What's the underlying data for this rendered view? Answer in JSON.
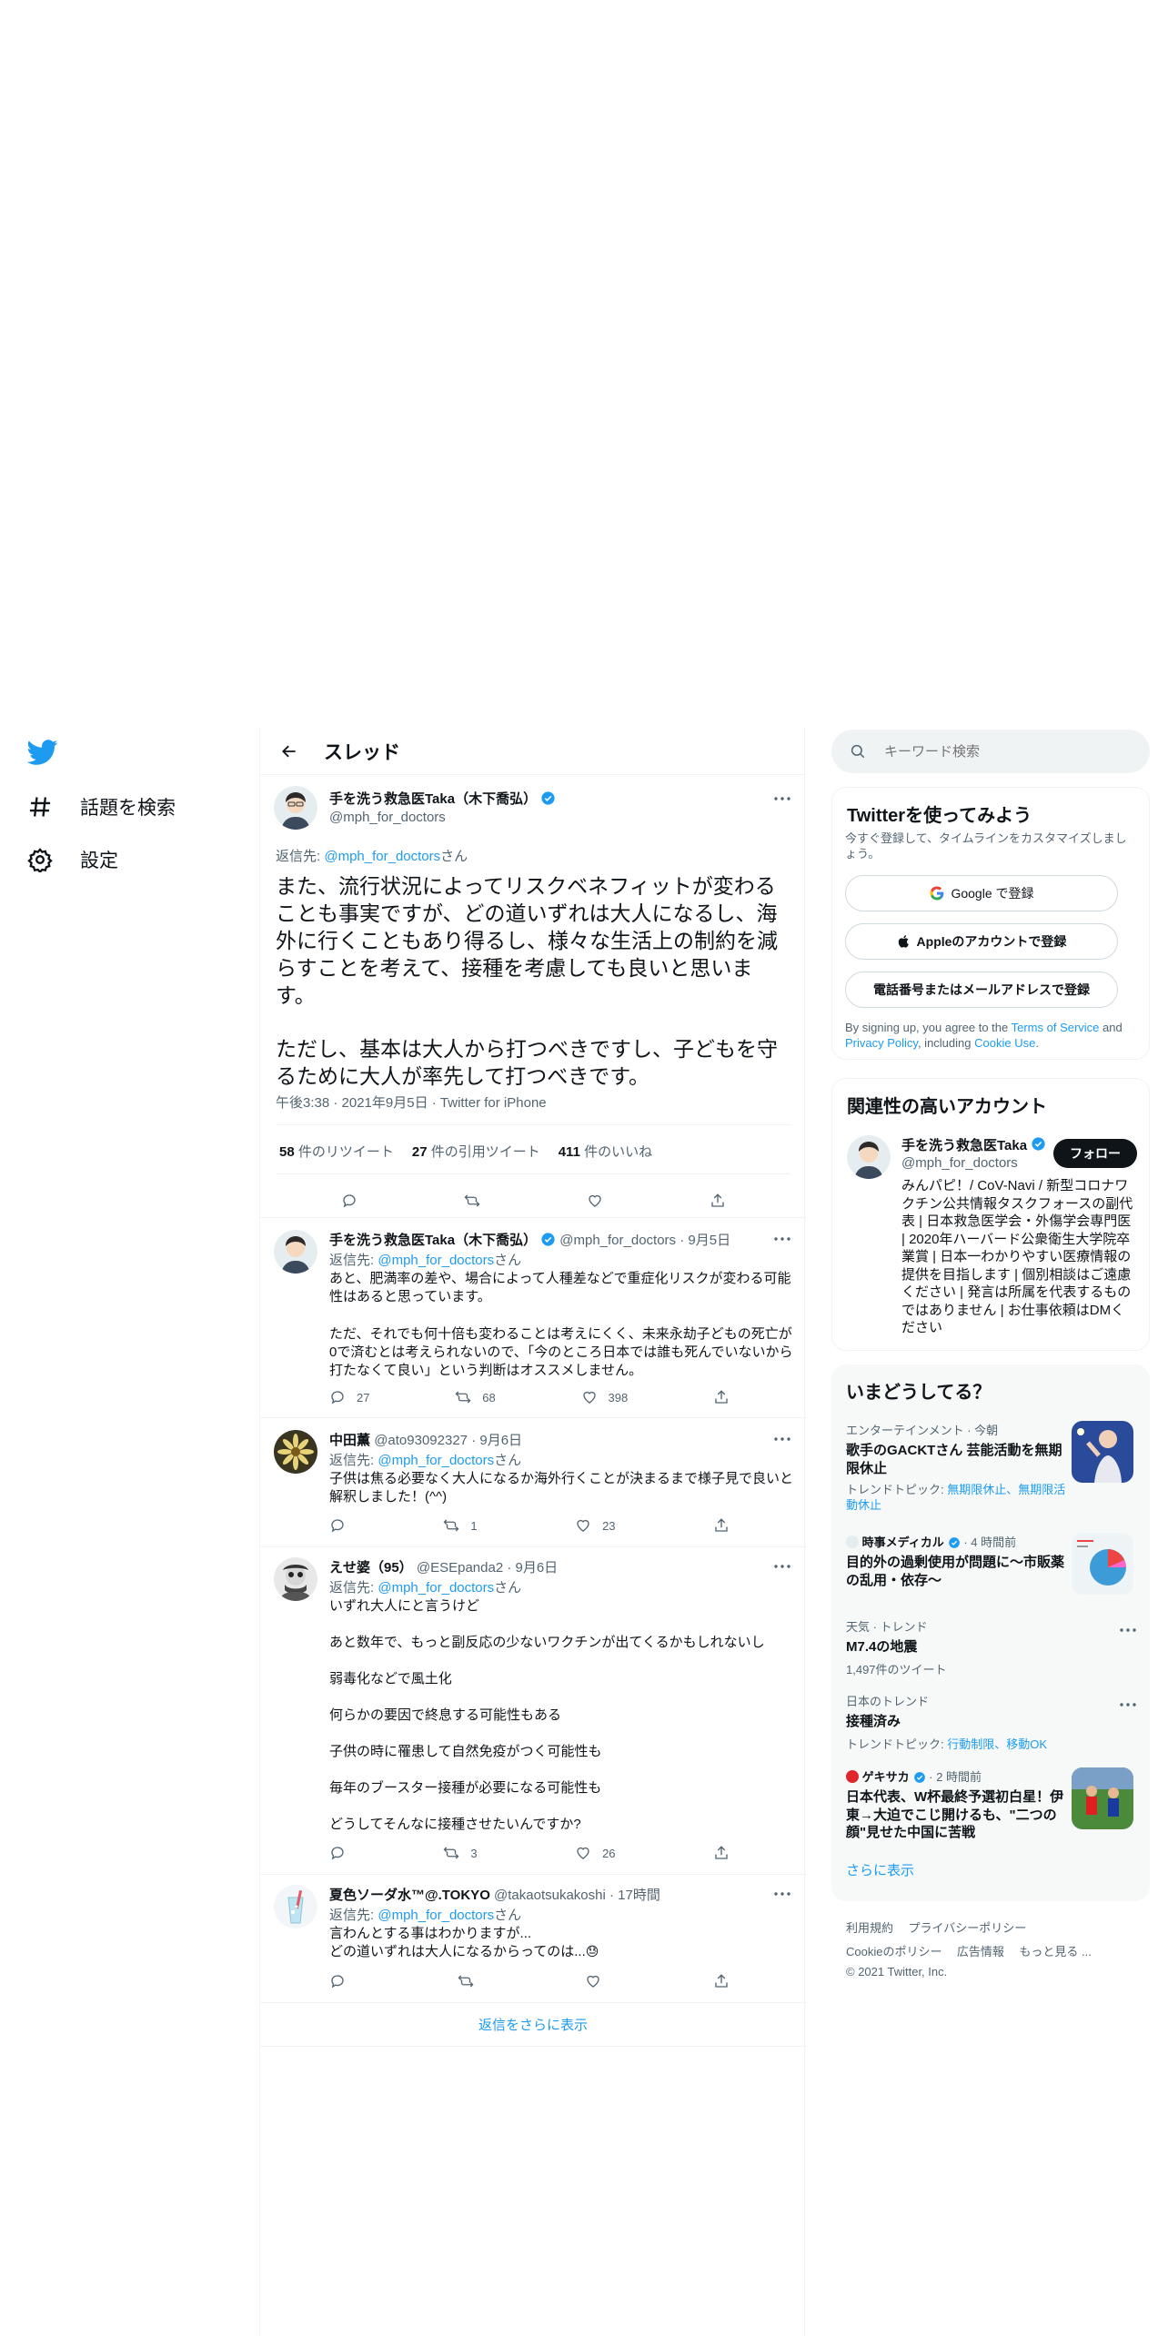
{
  "nav": {
    "explore": "話題を検索",
    "settings": "設定"
  },
  "header": {
    "title": "スレッド"
  },
  "main_tweet": {
    "name": "手を洗う救急医Taka（木下喬弘）",
    "handle": "@mph_for_doctors",
    "reply_prefix": "返信先: ",
    "reply_to": "@mph_for_doctors",
    "reply_suffix": "さん",
    "text1": "また、流行状況によってリスクベネフィットが変わることも事実ですが、どの道いずれは大人になるし、海外に行くこともあり得るし、様々な生活上の制約を減らすことを考えて、接種を考慮しても良いと思います。",
    "text2": "ただし、基本は大人から打つべきですし、子どもを守るために大人が率先して打つべきです。",
    "meta": "午後3:38 · 2021年9月5日 · Twitter for iPhone",
    "retweets": "58",
    "retweets_label": " 件のリツイート",
    "quotes": "27",
    "quotes_label": " 件の引用ツイート",
    "likes": "411",
    "likes_label": " 件のいいね"
  },
  "replies": [
    {
      "name": "手を洗う救急医Taka（木下喬弘）",
      "handle": "@mph_for_doctors",
      "time": "· 9月5日",
      "reply_prefix": "返信先: ",
      "reply_to": "@mph_for_doctors",
      "reply_suffix": "さん",
      "text": "あと、肥満率の差や、場合によって人種差などで重症化リスクが変わる可能性はあると思っています。\n\nただ、それでも何十倍も変わることは考えにくく、未来永劫子どもの死亡が0で済むとは考えられないので、「今のところ日本では誰も死んでいないから打たなくて良い」という判断はオススメしません。",
      "replies": "27",
      "retweets": "68",
      "likes": "398"
    },
    {
      "name": "中田薫",
      "handle": "@ato93092327",
      "time": "· 9月6日",
      "reply_prefix": "返信先: ",
      "reply_to": "@mph_for_doctors",
      "reply_suffix": "さん",
      "text": "子供は焦る必要なく大人になるか海外行くことが決まるまで様子見で良いと解釈しました！(^^)",
      "replies": "",
      "retweets": "1",
      "likes": "23"
    },
    {
      "name": "えせ婆（95）",
      "handle": "@ESEpanda2",
      "time": "· 9月6日",
      "reply_prefix": "返信先: ",
      "reply_to": "@mph_for_doctors",
      "reply_suffix": "さん",
      "text": "いずれ大人にと言うけど\n\nあと数年で、もっと副反応の少ないワクチンが出てくるかもしれないし\n\n弱毒化などで風土化\n\n何らかの要因で終息する可能性もある\n\n子供の時に罹患して自然免疫がつく可能性も\n\n毎年のブースター接種が必要になる可能性も\n\nどうしてそんなに接種させたいんですか?",
      "replies": "",
      "retweets": "3",
      "likes": "26"
    },
    {
      "name": "夏色ソーダ水™@.TOKYO",
      "handle": "@takaotsukakoshi",
      "time": "· 17時間",
      "reply_prefix": "返信先: ",
      "reply_to": "@mph_for_doctors",
      "reply_suffix": "さん",
      "text": "言わんとする事はわかりますが...\nどの道いずれは大人になるからってのは...",
      "emoji": "😓",
      "replies": "",
      "retweets": "",
      "likes": ""
    }
  ],
  "show_more_replies": "返信をさらに表示",
  "search": {
    "placeholder": "キーワード検索"
  },
  "signup": {
    "title": "Twitterを使ってみよう",
    "subtitle": "今すぐ登録して、タイムラインをカスタマイズしましょう。",
    "google": "Google で登録",
    "apple": "Appleのアカウントで登録",
    "phone": "電話番号またはメールアドレスで登録",
    "terms_prefix": "By signing up, you agree to the ",
    "terms_link": "Terms of Service",
    "terms_and": " and ",
    "privacy_link": "Privacy Policy",
    "terms_including": ", including ",
    "cookie_link": "Cookie Use",
    "terms_end": "."
  },
  "related": {
    "title": "関連性の高いアカウント",
    "name": "手を洗う救急医Taka（木下喬弘）",
    "handle": "@mph_for_doctors",
    "follow": "フォロー",
    "bio": "みんパピ！/ CoV-Navi / 新型コロナワクチン公共情報タスクフォースの副代表 | 日本救急医学会・外傷学会専門医 | 2020年ハーバード公衆衛生大学院卒業賞 | 日本一わかりやすい医療情報の提供を目指します | 個別相談はご遠慮ください | 発言は所属を代表するものではありません | お仕事依頼はDMください"
  },
  "trends": {
    "title": "いまどうしてる？",
    "items": [
      {
        "category": "エンターテインメント · 今朝",
        "name": "歌手のGACKTさん 芸能活動を無期限休止",
        "sub_prefix": "トレンドトピック: ",
        "sub_links": "無期限休止、無期限活動休止"
      },
      {
        "source": "時事メディカル",
        "time": "· 4 時間前",
        "name": "目的外の過剰使用が問題に～市販薬の乱用・依存～"
      },
      {
        "category": "天気 · トレンド",
        "name": "M7.4の地震",
        "sub": "1,497件のツイート"
      },
      {
        "category": "日本のトレンド",
        "name": "接種済み",
        "sub_prefix": "トレンドトピック: ",
        "sub_links": "行動制限、移動OK"
      },
      {
        "source": "ゲキサカ",
        "time": "· 2 時間前",
        "name": "日本代表、W杯最終予選初白星！伊東→大迫でこじ開けるも、\"二つの顔\"見せた中国に苦戦"
      }
    ],
    "show_more": "さらに表示"
  },
  "footer": {
    "terms": "利用規約",
    "privacy": "プライバシーポリシー",
    "cookie": "Cookieのポリシー",
    "ads": "広告情報",
    "more": "もっと見る ...",
    "copyright": "© 2021 Twitter, Inc."
  },
  "colors": {
    "accent": "#1d9bf0",
    "text": "#0f1419",
    "muted": "#536471",
    "border": "#eff3f4"
  }
}
